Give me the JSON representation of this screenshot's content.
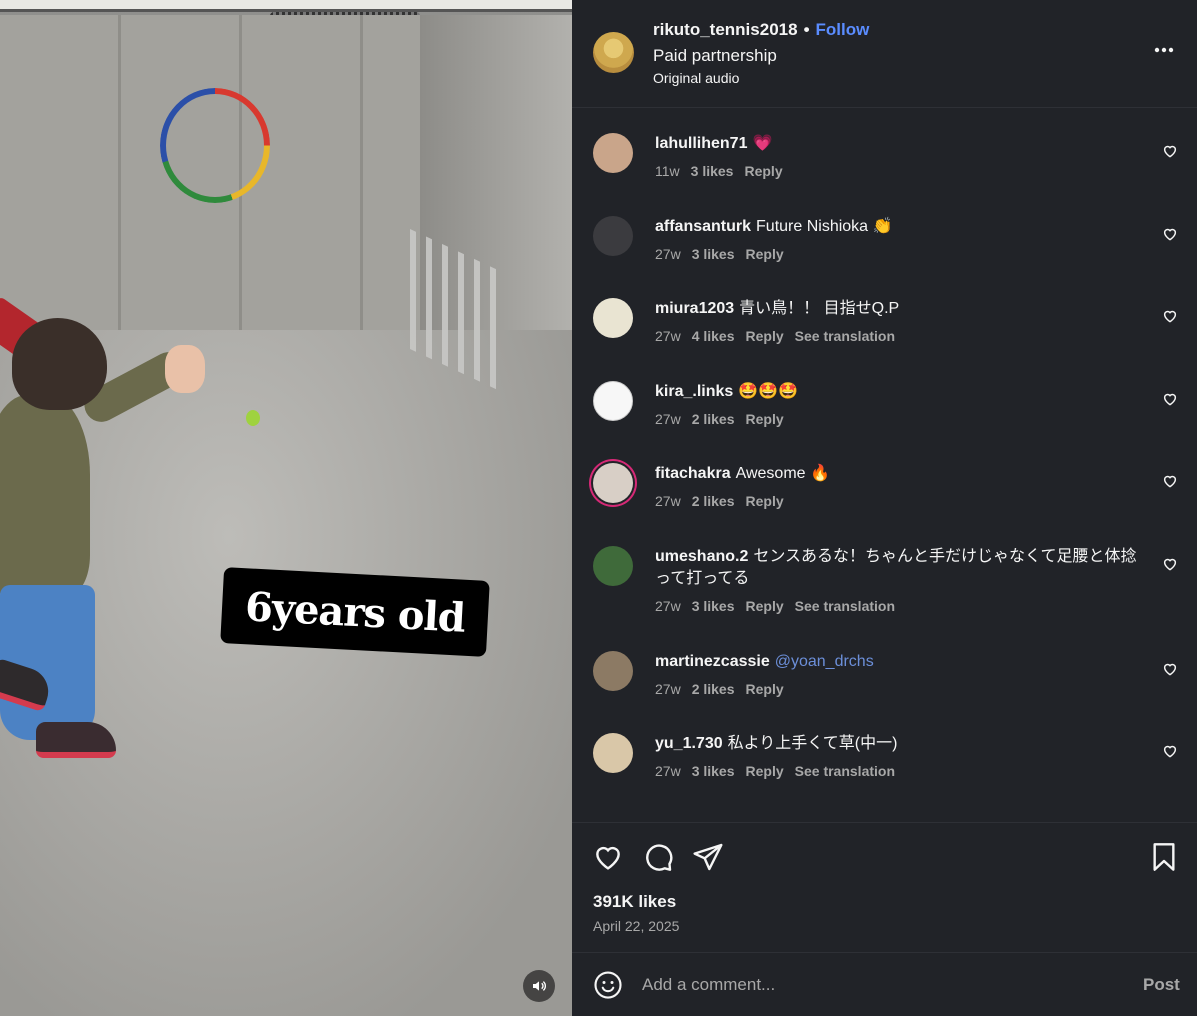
{
  "media": {
    "caption": "6years old",
    "sound_icon": "speaker-icon"
  },
  "post": {
    "username": "rikuto_tennis2018",
    "separator": "•",
    "follow_label": "Follow",
    "partnership": "Paid partnership",
    "audio": "Original audio",
    "more_icon": "more-dots-icon"
  },
  "comments": [
    {
      "username": "lahullihen71",
      "text": "💗",
      "time": "11w",
      "likes": "3 likes",
      "reply": "Reply",
      "translate": "",
      "avatar_color": "#c9a58a"
    },
    {
      "username": "affansanturk",
      "text": "Future Nishioka 👏",
      "time": "27w",
      "likes": "3 likes",
      "reply": "Reply",
      "translate": "",
      "avatar_color": "#3b3b3f"
    },
    {
      "username": "miura1203",
      "text": "青い鳥！！ 目指せQ.P",
      "time": "27w",
      "likes": "4 likes",
      "reply": "Reply",
      "translate": "See translation",
      "avatar_color": "#e9e4d2"
    },
    {
      "username": "kira_.links",
      "text": "🤩🤩🤩",
      "time": "27w",
      "likes": "2 likes",
      "reply": "Reply",
      "translate": "",
      "avatar_color": "#f7f7f7"
    },
    {
      "username": "fitachakra",
      "text": "Awesome 🔥",
      "time": "27w",
      "likes": "2 likes",
      "reply": "Reply",
      "translate": "",
      "avatar_color": "#d8cfc6"
    },
    {
      "username": "umeshano.2",
      "text": "センスあるな！ちゃんと手だけじゃなくて足腰と体捻って打ってる",
      "time": "27w",
      "likes": "3 likes",
      "reply": "Reply",
      "translate": "See translation",
      "avatar_color": "#3f6a3a"
    },
    {
      "username": "martinezcassie",
      "text": "@yoan_drchs",
      "time": "27w",
      "likes": "2 likes",
      "reply": "Reply",
      "translate": "",
      "avatar_color": "#8c7a64"
    },
    {
      "username": "yu_1.730",
      "text": "私より上手くて草(中一)",
      "time": "27w",
      "likes": "3 likes",
      "reply": "Reply",
      "translate": "See translation",
      "avatar_color": "#d9c7a8"
    }
  ],
  "actions": {
    "like_icon": "heart-icon",
    "comment_icon": "comment-bubble-icon",
    "share_icon": "paper-plane-icon",
    "save_icon": "bookmark-icon"
  },
  "stats": {
    "likes": "391K likes",
    "date": "April 22, 2025"
  },
  "compose": {
    "emoji_icon": "smiley-icon",
    "placeholder": "Add a comment...",
    "post_label": "Post"
  },
  "colors": {
    "panel_bg": "#212328",
    "link_blue": "#5a8cff",
    "mention_blue": "#6c8fd9",
    "muted": "#a8a8a8"
  }
}
